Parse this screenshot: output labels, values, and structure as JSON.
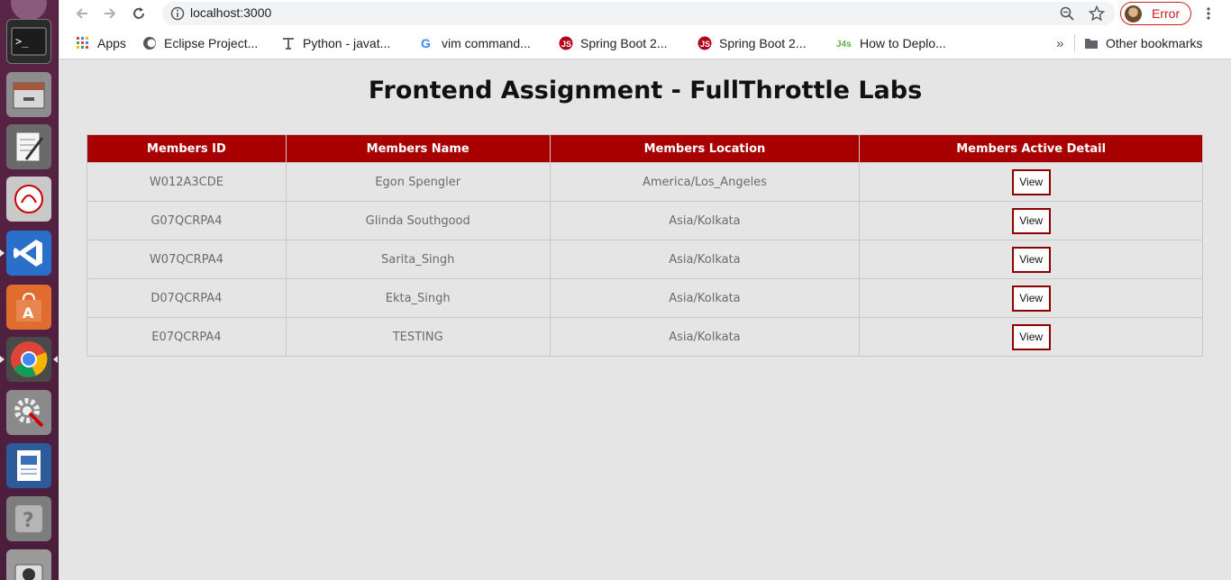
{
  "browser": {
    "url": "localhost:3000",
    "profile_status": "Error"
  },
  "bookmarks": {
    "items": [
      {
        "label": "Apps",
        "icon": "apps-grid-icon"
      },
      {
        "label": "Eclipse Project...",
        "icon": "eclipse-icon"
      },
      {
        "label": "Python - javat...",
        "icon": "typewriter-icon"
      },
      {
        "label": "vim command...",
        "icon": "google-icon"
      },
      {
        "label": "Spring Boot 2...",
        "icon": "spring-icon"
      },
      {
        "label": "Spring Boot 2...",
        "icon": "spring-icon"
      },
      {
        "label": "How to Deplo...",
        "icon": "j4s-icon"
      }
    ],
    "overflow_label": "»",
    "other_label": "Other bookmarks"
  },
  "page": {
    "title": "Frontend Assignment - FullThrottle Labs",
    "table": {
      "headers": [
        "Members ID",
        "Members Name",
        "Members Location",
        "Members Active Detail"
      ],
      "rows": [
        {
          "id": "W012A3CDE",
          "name": "Egon Spengler",
          "location": "America/Los_Angeles",
          "action": "View"
        },
        {
          "id": "G07QCRPA4",
          "name": "Glinda Southgood",
          "location": "Asia/Kolkata",
          "action": "View"
        },
        {
          "id": "W07QCRPA4",
          "name": "Sarita_Singh",
          "location": "Asia/Kolkata",
          "action": "View"
        },
        {
          "id": "D07QCRPA4",
          "name": "Ekta_Singh",
          "location": "Asia/Kolkata",
          "action": "View"
        },
        {
          "id": "E07QCRPA4",
          "name": "TESTING",
          "location": "Asia/Kolkata",
          "action": "View"
        }
      ]
    }
  },
  "colors": {
    "header_bg": "#a80000",
    "button_border": "#8b0000",
    "error": "#c5221f"
  }
}
